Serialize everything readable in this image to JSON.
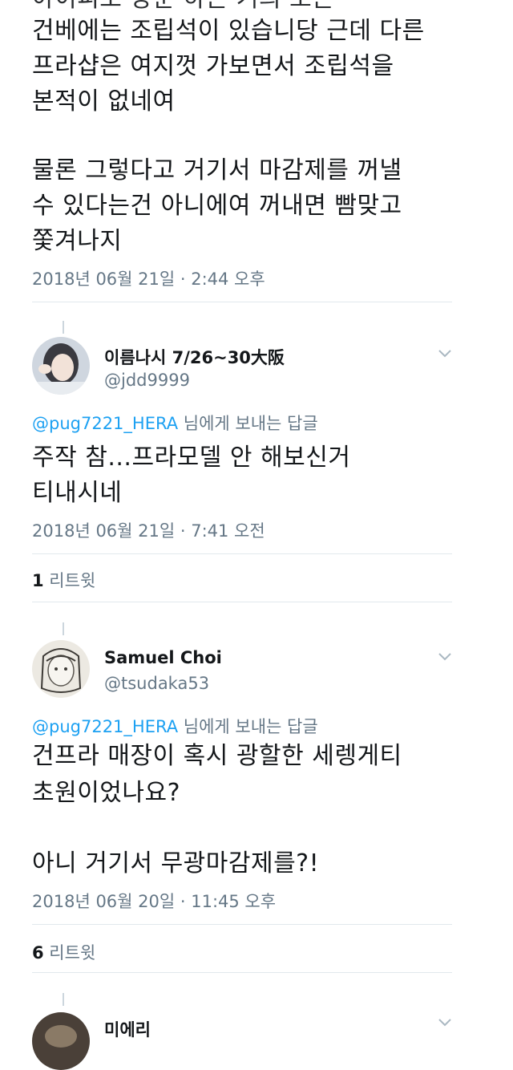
{
  "tweet0": {
    "partial_line": "아이피로 방문 하는 거의 모든",
    "lines": [
      "건베에는 조립석이 있습니당 근데 다른",
      "프라샵은 여지껏 가보면서 조립석을",
      "본적이 없네여",
      "",
      "물론 그렇다고 거기서 마감제를 꺼낼",
      "수 있다는건 아니에여 꺼내면 빰맞고",
      "쫓겨나지"
    ],
    "timestamp": "2018년 06월 21일 · 2:44 오후"
  },
  "tweet1": {
    "name": "이름나시 7/26~30大阪",
    "handle": "@jdd9999",
    "reply_to": "@pug7221_HERA",
    "reply_suffix": " 님에게 보내는 답글",
    "lines": [
      "주작 참...프라모델 안 해보신거",
      "티내시네"
    ],
    "timestamp": "2018년 06월 21일 · 7:41 오전",
    "retweet_count": "1",
    "retweet_label": " 리트윗"
  },
  "tweet2": {
    "name": "Samuel Choi",
    "handle": "@tsudaka53",
    "reply_to": "@pug7221_HERA",
    "reply_suffix": " 님에게 보내는 답글",
    "lines": [
      "건프라 매장이 혹시 광할한 세렝게티",
      "초원이었나요?",
      "",
      "아니 거기서 무광마감제를?!"
    ],
    "timestamp": "2018년 06월 20일 · 11:45 오후",
    "retweet_count": "6",
    "retweet_label": " 리트윗"
  },
  "tweet3": {
    "name_partial": "미에리"
  },
  "colors": {
    "text": "#14171a",
    "secondary": "#657786",
    "link": "#1da1f2",
    "divider": "#e1e8ed"
  }
}
